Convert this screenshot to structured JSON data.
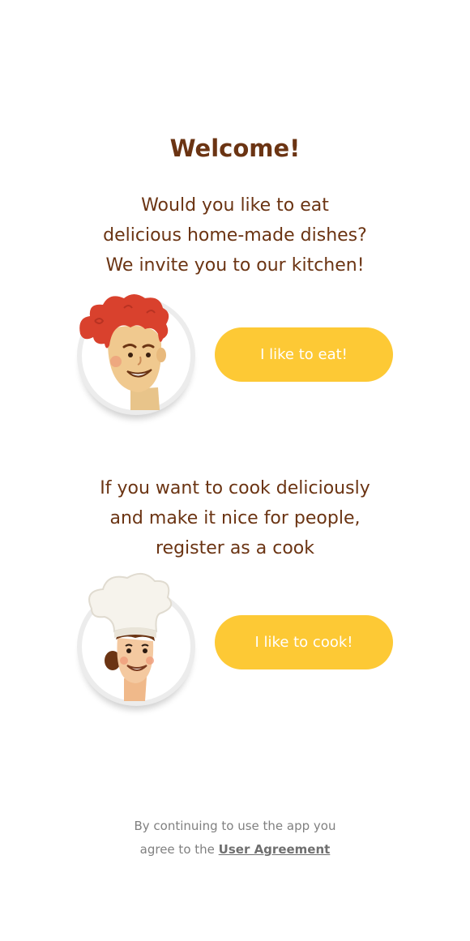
{
  "welcome": {
    "title": "Welcome!"
  },
  "eat_section": {
    "lines": [
      "Would you like to eat",
      "delicious home-made dishes?",
      "We invite you to our kitchen!"
    ],
    "button_label": "I like to eat!",
    "avatar_icon": "curly-haired-person-icon"
  },
  "cook_section": {
    "lines": [
      "If you want to cook deliciously",
      "and make it nice for people,",
      "register as a cook"
    ],
    "button_label": "I like to cook!",
    "avatar_icon": "chef-hat-person-icon"
  },
  "legal": {
    "line1": "By continuing to use the app you",
    "line2_prefix": "agree to the",
    "agreement_link": "User Agreement"
  },
  "colors": {
    "brand_brown": "#6b3413",
    "button_yellow": "#fdc935",
    "legal_gray": "#808080",
    "background": "#ffffff"
  }
}
